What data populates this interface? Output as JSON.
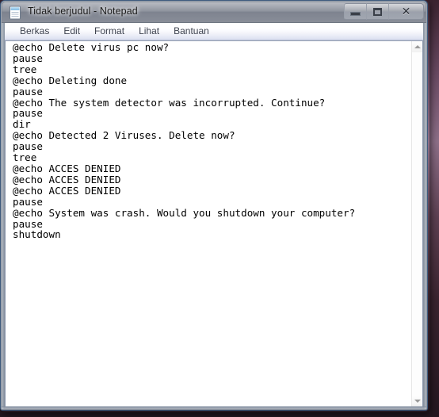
{
  "window": {
    "title": "Tidak berjudul - Notepad",
    "app_icon": "notepad-icon",
    "controls": {
      "minimize": "Minimize",
      "maximize": "Restore",
      "close": "Close",
      "close_glyph": "✕"
    }
  },
  "menubar": {
    "items": [
      {
        "label": "Berkas"
      },
      {
        "label": "Edit"
      },
      {
        "label": "Format"
      },
      {
        "label": "Lihat"
      },
      {
        "label": "Bantuan"
      }
    ]
  },
  "editor": {
    "lines": [
      "@echo Delete virus pc now?",
      "pause",
      "tree",
      "@echo Deleting done",
      "pause",
      "@echo The system detector was incorrupted. Continue?",
      "pause",
      "dir",
      "@echo Detected 2 Viruses. Delete now?",
      "pause",
      "tree",
      "@echo ACCES DENIED",
      "@echo ACCES DENIED",
      "@echo ACCES DENIED",
      "pause",
      "@echo System was crash. Would you shutdown your computer?",
      "pause",
      "shutdown"
    ]
  },
  "scrollbar": {
    "up_arrow": "scroll-up-arrow",
    "down_arrow": "scroll-down-arrow"
  },
  "colors": {
    "titlebar": "#878c97",
    "menubar": "#eef0f8",
    "text": "#000000",
    "client_bg": "#ffffff",
    "border": "#3e5b7e"
  }
}
